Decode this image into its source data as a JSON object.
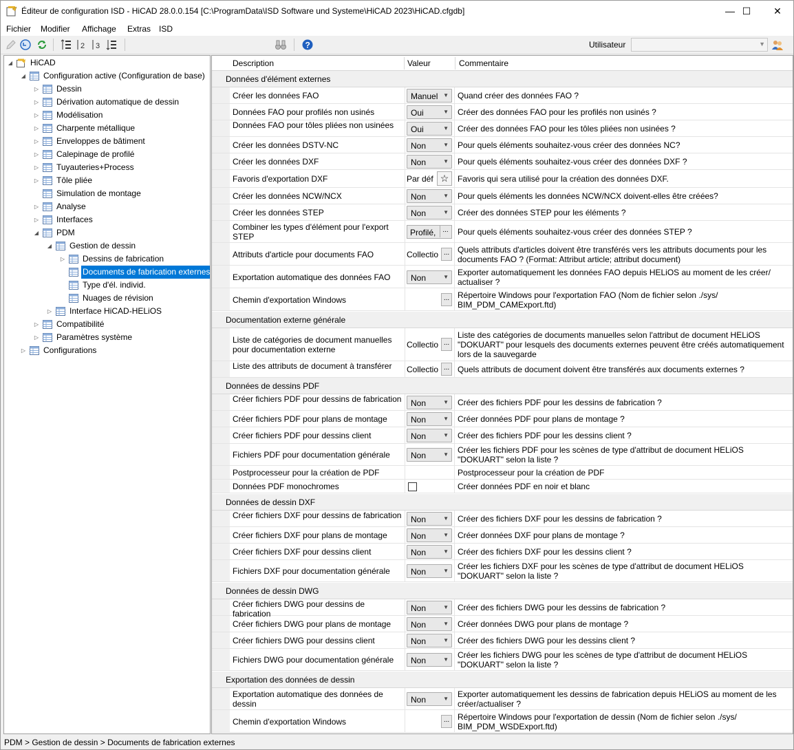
{
  "window": {
    "title": "Éditeur de configuration ISD  - HiCAD 28.0.0.154 [C:\\ProgramData\\ISD Software und Systeme\\HiCAD 2023\\HiCAD.cfgdb]",
    "minimize": "—",
    "maximize": "☐",
    "close": "✕"
  },
  "menu": [
    "Fichier",
    "Modifier",
    "Affichage",
    "Extras",
    "ISD"
  ],
  "toolbar": {
    "icons": [
      "pencil-icon",
      "undo-icon",
      "refresh-icon",
      "sort-1-icon",
      "sort-2-icon",
      "sort-3-icon",
      "sort-4-icon",
      "binoculars-icon",
      "help-icon",
      "users-icon"
    ],
    "user_label": "Utilisateur",
    "user_value": ""
  },
  "tree": [
    {
      "label": "HiCAD",
      "exp": "◢",
      "icon": "hicad"
    },
    {
      "label": "Configuration active (Configuration de base)",
      "exp": "◢",
      "icon": "table"
    },
    {
      "label": "Dessin",
      "exp": "▷",
      "icon": "table"
    },
    {
      "label": "Dérivation automatique de dessin",
      "exp": "▷",
      "icon": "table"
    },
    {
      "label": "Modélisation",
      "exp": "▷",
      "icon": "table"
    },
    {
      "label": "Charpente métallique",
      "exp": "▷",
      "icon": "table"
    },
    {
      "label": "Enveloppes de bâtiment",
      "exp": "▷",
      "icon": "table"
    },
    {
      "label": "Calepinage de profilé",
      "exp": "▷",
      "icon": "table"
    },
    {
      "label": "Tuyauteries+Process",
      "exp": "▷",
      "icon": "table"
    },
    {
      "label": "Tôle pliée",
      "exp": "▷",
      "icon": "table"
    },
    {
      "label": "Simulation de montage",
      "exp": "",
      "icon": "table"
    },
    {
      "label": "Analyse",
      "exp": "▷",
      "icon": "table"
    },
    {
      "label": "Interfaces",
      "exp": "▷",
      "icon": "table"
    },
    {
      "label": "PDM",
      "exp": "◢",
      "icon": "table"
    },
    {
      "label": "Gestion de dessin",
      "exp": "◢",
      "icon": "table"
    },
    {
      "label": "Dessins de fabrication",
      "exp": "▷",
      "icon": "table"
    },
    {
      "label": "Documents de fabrication externes",
      "exp": "",
      "icon": "table",
      "selected": true
    },
    {
      "label": "Type d'él. individ.",
      "exp": "",
      "icon": "table"
    },
    {
      "label": "Nuages de révision",
      "exp": "",
      "icon": "table"
    },
    {
      "label": "Interface HiCAD-HELiOS",
      "exp": "▷",
      "icon": "table"
    },
    {
      "label": "Compatibilité",
      "exp": "▷",
      "icon": "table"
    },
    {
      "label": "Paramètres système",
      "exp": "▷",
      "icon": "table"
    },
    {
      "label": "Configurations",
      "exp": "▷",
      "icon": "table"
    }
  ],
  "grid": {
    "headers": [
      "Description",
      "Valeur",
      "Commentaire"
    ],
    "sections": [
      {
        "title": "Données d'élément externes",
        "rows": [
          {
            "desc": "Créer les données FAO",
            "type": "combo",
            "value": "Manuel",
            "comment": "Quand créer des données FAO ?"
          },
          {
            "desc": "Données FAO pour profilés non usinés",
            "type": "combo",
            "value": "Oui",
            "comment": "Créer des données FAO pour les profilés non usinés ?"
          },
          {
            "desc": "Données FAO pour tôles pliées non usinées",
            "type": "combo",
            "value": "Oui",
            "comment": "Créer des données FAO pour les tôles pliées non usinées ?"
          },
          {
            "desc": "Créer les données DSTV-NC",
            "type": "combo",
            "value": "Non",
            "comment": "Pour quels éléments souhaitez-vous créer des données NC?"
          },
          {
            "desc": "Créer les données DXF",
            "type": "combo",
            "value": "Non",
            "comment": "Pour quels éléments souhaitez-vous créer des données DXF ?"
          },
          {
            "desc": "Favoris d'exportation DXF",
            "type": "star",
            "value": "Par déf",
            "comment": "Favoris qui sera utilisé pour la création des données DXF."
          },
          {
            "desc": "Créer les données NCW/NCX",
            "type": "combo",
            "value": "Non",
            "comment": "Pour quels éléments les données NCW/NCX doivent-elles être créées?"
          },
          {
            "desc": "Créer les données STEP",
            "type": "combo",
            "value": "Non",
            "comment": "Créer des données STEP pour les éléments ?"
          },
          {
            "desc": "Combiner les types d'élément pour l'export STEP",
            "type": "button",
            "value": "Profilé,",
            "comment": "Pour quels éléments souhaitez-vous créer des données STEP ?"
          },
          {
            "desc": "Attributs d'article pour documents FAO",
            "type": "dots",
            "value": "Collectio",
            "comment": "Quels attributs d'articles doivent être transférés vers les attributs documents pour les documents FAO ?  (Format: Attribut article; attribut document)"
          },
          {
            "desc": "Exportation automatique des données FAO",
            "type": "combo",
            "value": "Non",
            "comment": "Exporter automatiquement les données FAO depuis HELiOS au moment de les créer/ actualiser ?"
          },
          {
            "desc": "Chemin d'exportation Windows",
            "type": "dots",
            "value": "",
            "comment": "Répertoire Windows pour l'exportation FAO (Nom de fichier selon ./sys/ BIM_PDM_CAMExport.ftd)"
          }
        ]
      },
      {
        "title": "Documentation externe générale",
        "rows": [
          {
            "desc": "Liste de catégories de document manuelles pour documentation externe",
            "type": "dots",
            "value": "Collectio",
            "comment": "Liste des catégories de documents manuelles selon l'attribut de document HELiOS \"DOKUART\" pour lesquels des documents externes peuvent être créés automatiquement lors de la sauvegarde"
          },
          {
            "desc": "Liste des attributs de document à transférer",
            "type": "dots",
            "value": "Collectio",
            "comment": "Quels attributs de document doivent être transférés aux documents externes ?"
          }
        ]
      },
      {
        "title": "Données de dessins PDF",
        "rows": [
          {
            "desc": "Créer fichiers PDF pour dessins de fabrication",
            "type": "combo",
            "value": "Non",
            "comment": "Créer des fichiers PDF pour les dessins de fabrication ?"
          },
          {
            "desc": "Créer fichiers PDF pour plans de montage",
            "type": "combo",
            "value": "Non",
            "comment": "Créer données PDF pour plans de montage ?"
          },
          {
            "desc": "Créer fichiers PDF pour dessins client",
            "type": "combo",
            "value": "Non",
            "comment": "Créer des fichiers PDF pour les dessins client ?"
          },
          {
            "desc": "Fichiers PDF pour documentation générale",
            "type": "combo",
            "value": "Non",
            "comment": "Créer les fichiers PDF pour les scènes de type d'attribut de document HELiOS \"DOKUART\" selon la liste ?"
          },
          {
            "desc": "Postprocesseur pour la création de PDF",
            "type": "none",
            "value": "",
            "comment": "Postprocesseur pour la création de PDF"
          },
          {
            "desc": "Données PDF monochromes",
            "type": "check",
            "value": "",
            "comment": "Créer données PDF en noir et blanc"
          }
        ]
      },
      {
        "title": "Données de dessin DXF",
        "rows": [
          {
            "desc": "Créer fichiers DXF pour dessins de fabrication",
            "type": "combo",
            "value": "Non",
            "comment": "Créer des fichiers DXF pour les dessins de fabrication ?"
          },
          {
            "desc": "Créer fichiers DXF pour plans de montage",
            "type": "combo",
            "value": "Non",
            "comment": "Créer données DXF pour plans de montage ?"
          },
          {
            "desc": "Créer fichiers DXF pour dessins client",
            "type": "combo",
            "value": "Non",
            "comment": "Créer des fichiers DXF pour les dessins client ?"
          },
          {
            "desc": "Fichiers DXF pour documentation générale",
            "type": "combo",
            "value": "Non",
            "comment": "Créer les fichiers DXF pour les scènes de type d'attribut de document HELiOS \"DOKUART\" selon la liste ?"
          }
        ]
      },
      {
        "title": "Données de dessin DWG",
        "rows": [
          {
            "desc": "Créer fichiers DWG pour dessins de fabrication",
            "type": "combo",
            "value": "Non",
            "comment": "Créer des fichiers DWG pour les dessins de fabrication ?"
          },
          {
            "desc": "Créer fichiers DWG pour plans de montage",
            "type": "combo",
            "value": "Non",
            "comment": "Créer données DWG pour plans de montage ?"
          },
          {
            "desc": "Créer fichiers DWG pour dessins client",
            "type": "combo",
            "value": "Non",
            "comment": "Créer des fichiers DWG pour les dessins client ?"
          },
          {
            "desc": "Fichiers DWG pour documentation générale",
            "type": "combo",
            "value": "Non",
            "comment": "Créer les fichiers DWG pour les scènes de type d'attribut de document HELiOS \"DOKUART\" selon la liste ?"
          }
        ]
      },
      {
        "title": "Exportation des données de dessin",
        "rows": [
          {
            "desc": "Exportation automatique des données de dessin",
            "type": "combo",
            "value": "Non",
            "comment": "Exporter automatiquement les dessins de fabrication depuis HELiOS au moment de les créer/actualiser ?"
          },
          {
            "desc": "Chemin d'exportation Windows",
            "type": "dots",
            "value": "",
            "comment": "Répertoire Windows pour l'exportation de dessin (Nom de fichier selon ./sys/ BIM_PDM_WSDExport.ftd)"
          }
        ]
      }
    ]
  },
  "status": "PDM > Gestion de dessin > Documents de fabrication externes"
}
